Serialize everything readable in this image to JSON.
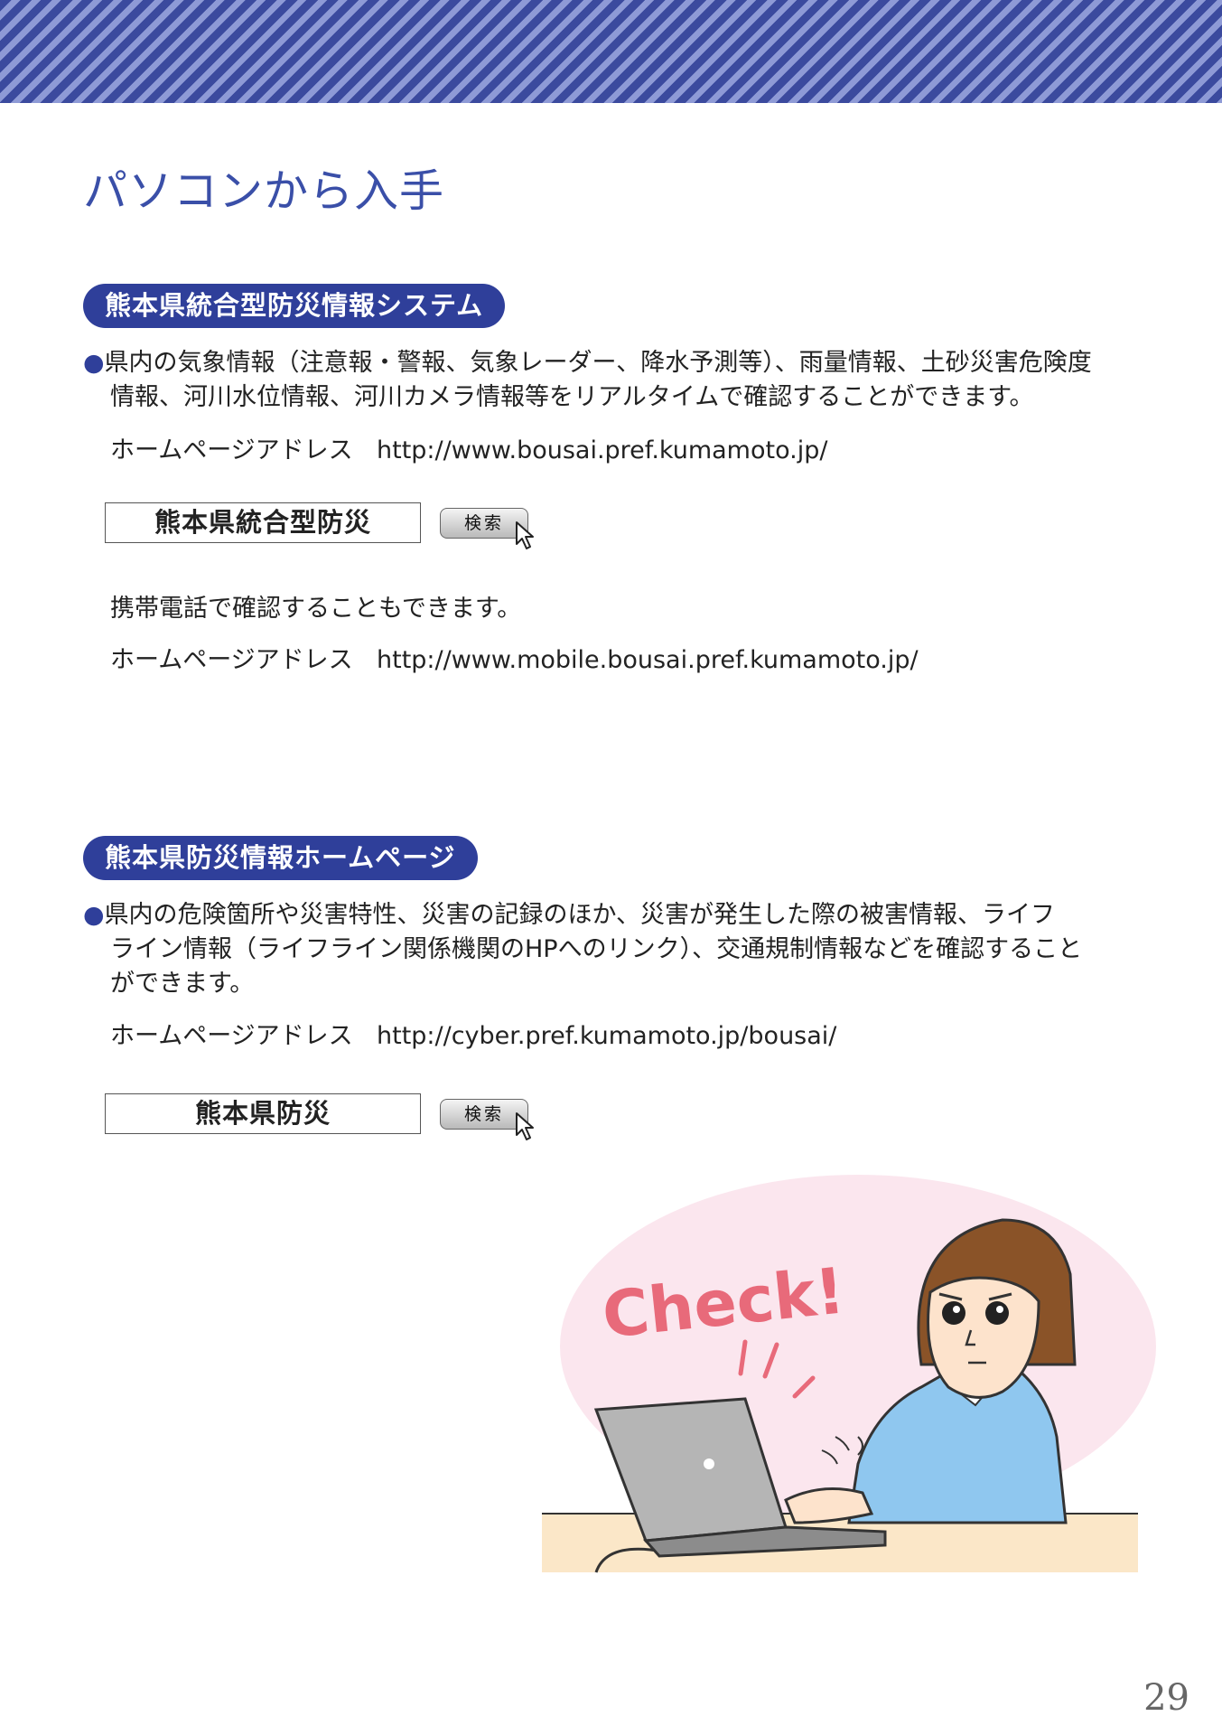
{
  "page": {
    "title": "パソコンから入手",
    "page_number": "29"
  },
  "section1": {
    "heading": "熊本県統合型防災情報システム",
    "bullet": "●",
    "description_line1": "県内の気象情報（注意報・警報、気象レーダー、降水予測等）、雨量情報、土砂災害危険度",
    "description_line2": "情報、河川水位情報、河川カメラ情報等をリアルタイムで確認することができます。",
    "address_label": "ホームページアドレス",
    "address_url": "http://www.bousai.pref.kumamoto.jp/",
    "search_keyword": "熊本県統合型防災",
    "search_button": "検索",
    "mobile_text": "携帯電話で確認することもできます。",
    "mobile_address_label": "ホームページアドレス",
    "mobile_address_url": "http://www.mobile.bousai.pref.kumamoto.jp/"
  },
  "section2": {
    "heading": "熊本県防災情報ホームページ",
    "bullet": "●",
    "description_line1": "県内の危険箇所や災害特性、災害の記録のほか、災害が発生した際の被害情報、ライフ",
    "description_line2": "ライン情報（ライフライン関係機関のHPへのリンク）、交通規制情報などを確認すること",
    "description_line3": "ができます。",
    "address_label": "ホームページアドレス",
    "address_url": "http://cyber.pref.kumamoto.jp/bousai/",
    "search_keyword": "熊本県防災",
    "search_button": "検索"
  },
  "illustration": {
    "caption": "Check!"
  },
  "colors": {
    "accent": "#2f3f9a",
    "title": "#3a4fa8",
    "check": "#e86a7a"
  }
}
